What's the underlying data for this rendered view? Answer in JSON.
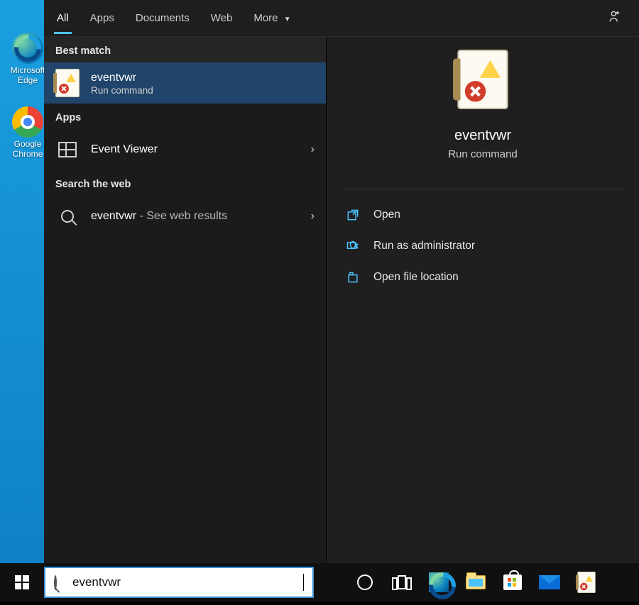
{
  "desktop": {
    "icons": {
      "edge": "Microsoft Edge",
      "chrome": "Google Chrome"
    }
  },
  "search_panel": {
    "tabs": {
      "all": "All",
      "apps": "Apps",
      "documents": "Documents",
      "web": "Web",
      "more": "More"
    },
    "groups": {
      "best_match": "Best match",
      "apps": "Apps",
      "search_web": "Search the web"
    },
    "best_match_result": {
      "title": "eventvwr",
      "subtitle": "Run command"
    },
    "app_result": {
      "title": "Event Viewer"
    },
    "web_result": {
      "query": "eventvwr",
      "suffix": " - See web results"
    },
    "preview": {
      "title": "eventvwr",
      "subtitle": "Run command",
      "actions": {
        "open": "Open",
        "run_admin": "Run as administrator",
        "open_location": "Open file location"
      }
    }
  },
  "taskbar": {
    "search_value": "eventvwr"
  }
}
